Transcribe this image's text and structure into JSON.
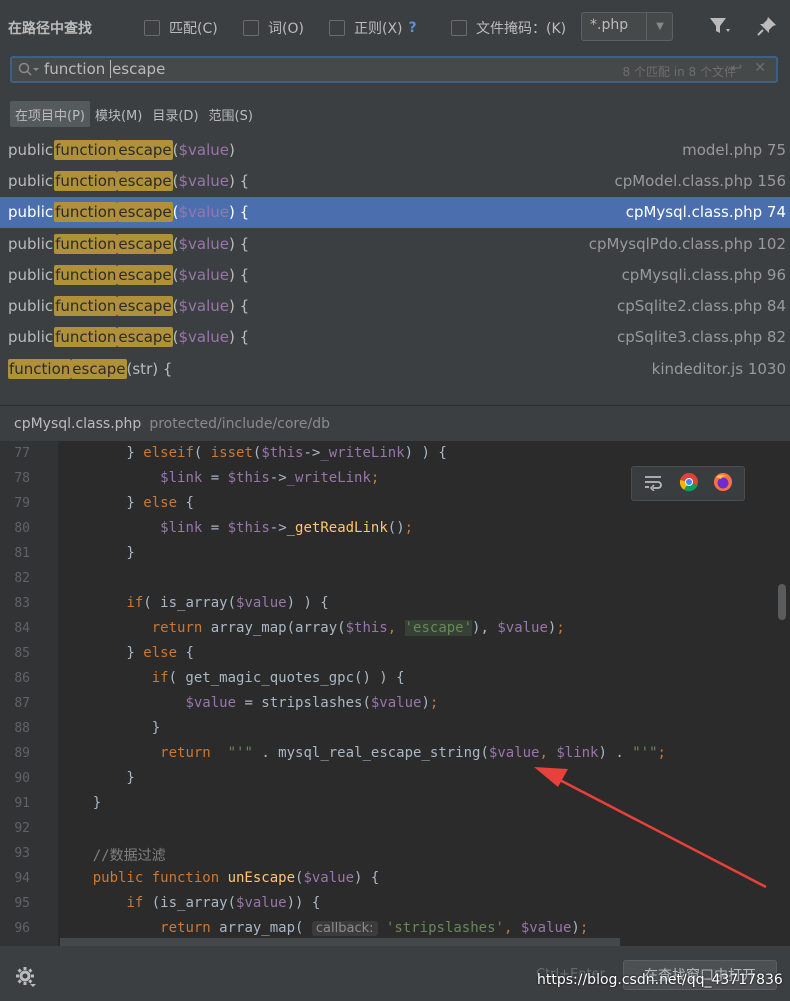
{
  "header": {
    "title": "在路径中查找",
    "options": [
      {
        "label": "匹配(C)"
      },
      {
        "label": "词(O)"
      },
      {
        "label": "正则(X)",
        "help": "?"
      }
    ],
    "file_mask_label": "文件掩码：(K)",
    "file_mask_value": "*.php"
  },
  "search": {
    "query_part1": "function",
    "query_part2": "escape",
    "match_count": "8 个匹配 in 8 个文件"
  },
  "scopes": [
    "在项目中(P)",
    "模块(M)",
    "目录(D)",
    "范围(S)"
  ],
  "results": [
    {
      "prefix": "public",
      "h1": "function",
      "h2": "escape",
      "paren": "(",
      "var": "$value",
      "suffix": ")",
      "file": "model.php 75"
    },
    {
      "prefix": "public",
      "h1": "function",
      "h2": "escape",
      "paren": "(",
      "var": "$value",
      "suffix": ") {",
      "file": "cpModel.class.php 156"
    },
    {
      "prefix": "public",
      "h1": "function",
      "h2": "escape",
      "paren": "(",
      "var": "$value",
      "suffix": ") {",
      "file": "cpMysql.class.php 74"
    },
    {
      "prefix": "public",
      "h1": "function",
      "h2": "escape",
      "paren": "(",
      "var": "$value",
      "suffix": ") {",
      "file": "cpMysqlPdo.class.php 102"
    },
    {
      "prefix": "public",
      "h1": "function",
      "h2": "escape",
      "paren": "(",
      "var": "$value",
      "suffix": ") {",
      "file": "cpMysqli.class.php 96"
    },
    {
      "prefix": "public",
      "h1": "function",
      "h2": "escape",
      "paren": "(",
      "var": "$value",
      "suffix": ") {",
      "file": "cpSqlite2.class.php 84"
    },
    {
      "prefix": "public",
      "h1": "function",
      "h2": "escape",
      "paren": "(",
      "var": "$value",
      "suffix": ") {",
      "file": "cpSqlite3.class.php 82"
    },
    {
      "prefix": "",
      "h1": "function",
      "h2": "escape",
      "paren": "(str) {",
      "var": "",
      "suffix": "",
      "file": "kindeditor.js 1030"
    }
  ],
  "preview": {
    "file": "cpMysql.class.php",
    "path": "protected/include/core/db"
  },
  "code": {
    "line_numbers": [
      "77",
      "78",
      "79",
      "80",
      "81",
      "82",
      "83",
      "84",
      "85",
      "86",
      "87",
      "88",
      "89",
      "90",
      "91",
      "92",
      "93",
      "94",
      "95",
      "96"
    ],
    "lines": [
      [
        [
          "pl",
          "        } "
        ],
        [
          "kw",
          "elseif"
        ],
        [
          "pl",
          "( "
        ],
        [
          "kw",
          "isset"
        ],
        [
          "pl",
          "("
        ],
        [
          "vr",
          "$this"
        ],
        [
          "pl",
          "->"
        ],
        [
          "vr",
          "_writeLink"
        ],
        [
          "pl",
          ") ) {"
        ]
      ],
      [
        [
          "pl",
          "            "
        ],
        [
          "vr",
          "$link"
        ],
        [
          "pl",
          " = "
        ],
        [
          "vr",
          "$this"
        ],
        [
          "pl",
          "->"
        ],
        [
          "vr",
          "_writeLink"
        ],
        [
          "kw",
          ";"
        ]
      ],
      [
        [
          "pl",
          "        } "
        ],
        [
          "kw",
          "else"
        ],
        [
          "pl",
          " {"
        ]
      ],
      [
        [
          "pl",
          "            "
        ],
        [
          "vr",
          "$link"
        ],
        [
          "pl",
          " = "
        ],
        [
          "vr",
          "$this"
        ],
        [
          "pl",
          "->"
        ],
        [
          "fn",
          "_getReadLink"
        ],
        [
          "pl",
          "()"
        ],
        [
          "kw",
          ";"
        ]
      ],
      [
        [
          "pl",
          "        }"
        ]
      ],
      [
        [
          "pl",
          ""
        ]
      ],
      [
        [
          "pl",
          "        "
        ],
        [
          "kw",
          "if"
        ],
        [
          "pl",
          "( is_array("
        ],
        [
          "vr",
          "$value"
        ],
        [
          "pl",
          ") ) {"
        ]
      ],
      [
        [
          "pl",
          "           "
        ],
        [
          "kw",
          "return"
        ],
        [
          "pl",
          " array_map(array("
        ],
        [
          "vr",
          "$this"
        ],
        [
          "kw",
          ", "
        ],
        [
          "esc",
          "'escape'"
        ],
        [
          "pl",
          "), "
        ],
        [
          "vr",
          "$value"
        ],
        [
          "pl",
          ")"
        ],
        [
          "kw",
          ";"
        ]
      ],
      [
        [
          "pl",
          "        } "
        ],
        [
          "kw",
          "else"
        ],
        [
          "pl",
          " {"
        ]
      ],
      [
        [
          "pl",
          "           "
        ],
        [
          "kw",
          "if"
        ],
        [
          "pl",
          "( get_magic_quotes_gpc() ) {"
        ]
      ],
      [
        [
          "pl",
          "               "
        ],
        [
          "vr",
          "$value"
        ],
        [
          "pl",
          " = stripslashes("
        ],
        [
          "vr",
          "$value"
        ],
        [
          "pl",
          ")"
        ],
        [
          "kw",
          ";"
        ]
      ],
      [
        [
          "pl",
          "           }"
        ]
      ],
      [
        [
          "pl",
          "            "
        ],
        [
          "kw",
          "return"
        ],
        [
          "pl",
          "  "
        ],
        [
          "st",
          "\"'\""
        ],
        [
          "pl",
          " . mysql_real_escape_string("
        ],
        [
          "vr",
          "$value"
        ],
        [
          "kw",
          ", "
        ],
        [
          "vr",
          "$link"
        ],
        [
          "pl",
          ") . "
        ],
        [
          "st",
          "\"'\""
        ],
        [
          "kw",
          ";"
        ]
      ],
      [
        [
          "pl",
          "        }"
        ]
      ],
      [
        [
          "pl",
          "    }"
        ]
      ],
      [
        [
          "pl",
          ""
        ]
      ],
      [
        [
          "cm",
          "    //数据过滤"
        ]
      ],
      [
        [
          "kw",
          "    public function "
        ],
        [
          "fn",
          "unEscape"
        ],
        [
          "pl",
          "("
        ],
        [
          "vr",
          "$value"
        ],
        [
          "pl",
          ") {"
        ]
      ],
      [
        [
          "pl",
          "        "
        ],
        [
          "kw",
          "if"
        ],
        [
          "pl",
          " (is_array("
        ],
        [
          "vr",
          "$value"
        ],
        [
          "pl",
          ")) {"
        ]
      ],
      [
        [
          "pl",
          "            "
        ],
        [
          "kw",
          "return"
        ],
        [
          "pl",
          " array_map( "
        ],
        [
          "hint",
          "callback:"
        ],
        [
          "pl",
          " "
        ],
        [
          "st",
          "'stripslashes'"
        ],
        [
          "kw",
          ", "
        ],
        [
          "vr",
          "$value"
        ],
        [
          "pl",
          ")"
        ],
        [
          "kw",
          ";"
        ]
      ]
    ]
  },
  "footer": {
    "shortcut": "Ctrl+Enter",
    "open_button": "在查找窗口中打开",
    "watermark": "https://blog.csdn.net/qq_43717836"
  },
  "colors": {
    "selection": "#4b6eaf",
    "match_highlight": "#b0913a",
    "arrow": "#e8403a"
  }
}
